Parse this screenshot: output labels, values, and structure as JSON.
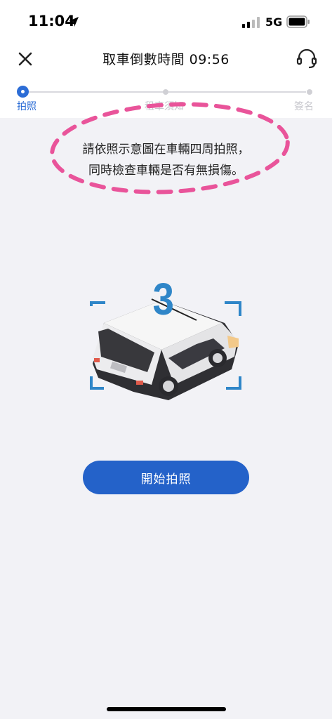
{
  "status_bar": {
    "time": "11:04",
    "network": "5G",
    "location_icon": "location-arrow-icon",
    "signal_icon": "cellular-signal-icon",
    "battery_icon": "battery-icon"
  },
  "nav": {
    "close_icon": "close-icon",
    "title": "取車倒數時間 09:56",
    "support_icon": "headset-support-icon"
  },
  "steps": [
    {
      "label": "拍照",
      "active": true
    },
    {
      "label": "租車須知",
      "active": false
    },
    {
      "label": "簽名",
      "active": false
    }
  ],
  "instruction": {
    "line1": "請依照示意圖在車輛四周拍照，",
    "line2": "同時檢查車輛是否有無損傷。"
  },
  "illustration": {
    "countdown_number": "3",
    "icon": "car-camera-frame-icon"
  },
  "actions": {
    "start_label": "開始拍照"
  },
  "colors": {
    "accent": "#2462c9",
    "annotation": "#e9549a",
    "background": "#f2f2f6"
  }
}
